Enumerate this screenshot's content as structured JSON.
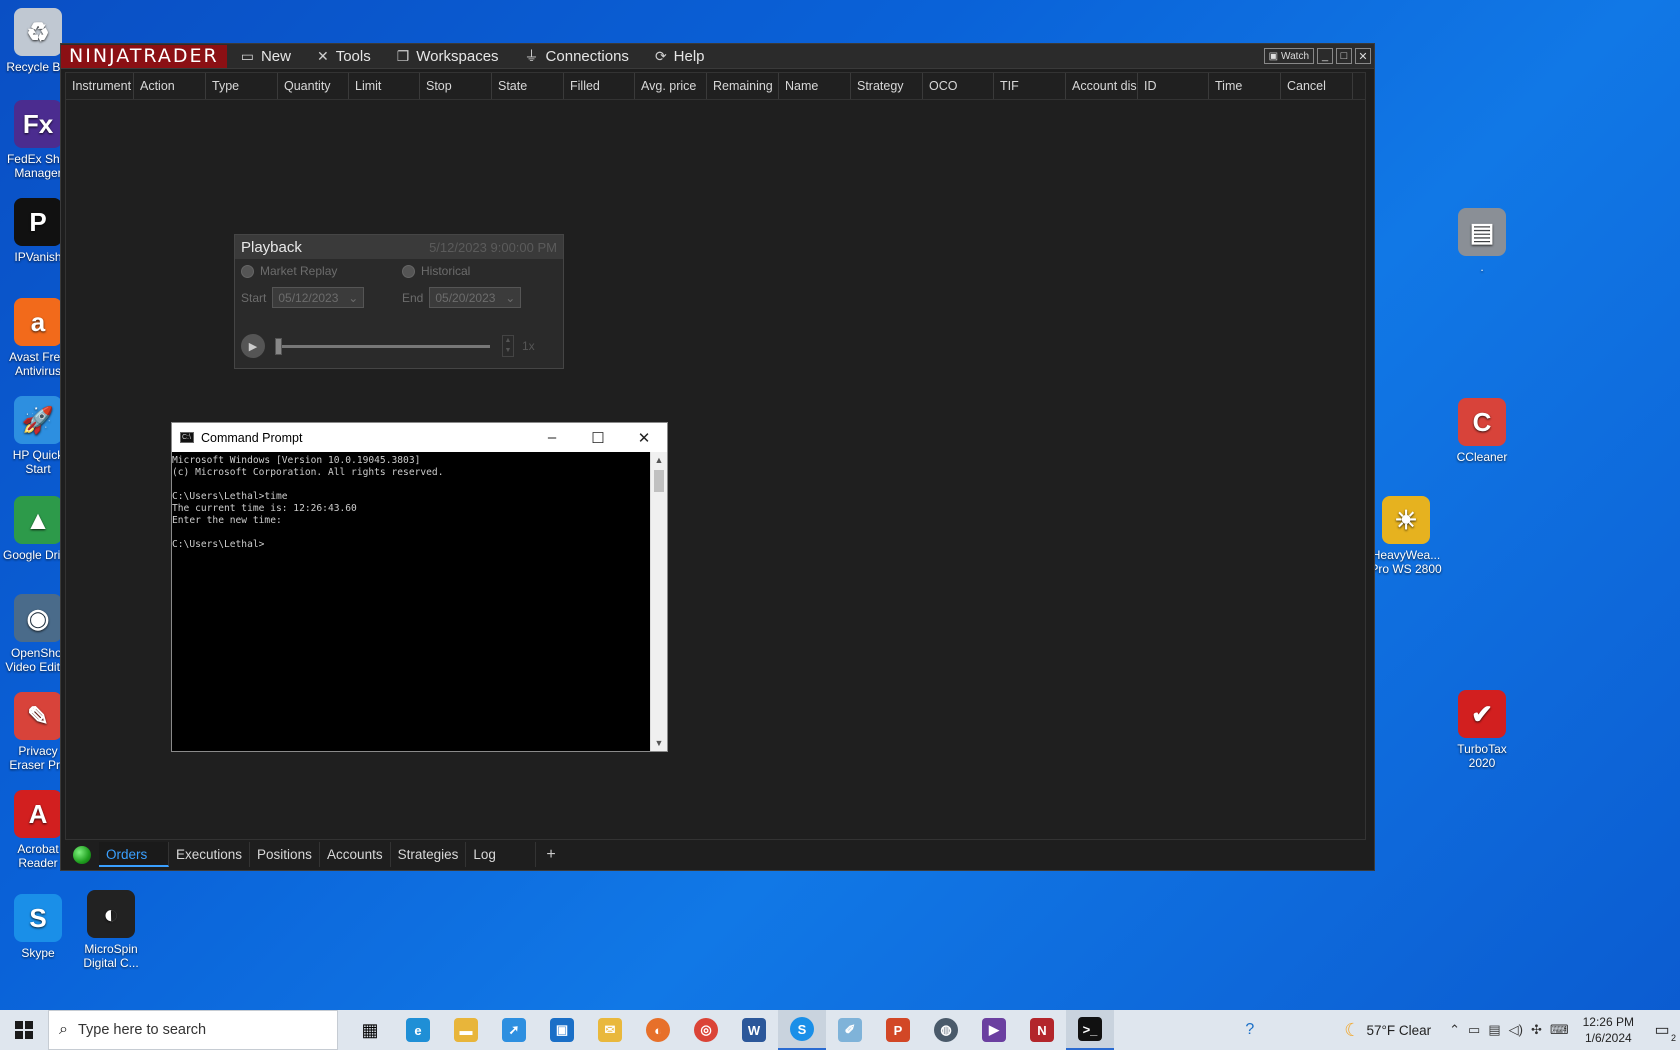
{
  "desktop_left": [
    {
      "label": "Recycle Bin",
      "icon": "recycle-bin-icon",
      "color": "#c0c8d2",
      "glyph": "♻"
    },
    {
      "label": "FedEx Ship Manager",
      "icon": "fedex-icon",
      "color": "#4b2c8f",
      "glyph": "Fx"
    },
    {
      "label": "IPVanish",
      "icon": "ipvanish-icon",
      "color": "#111111",
      "glyph": "P"
    },
    {
      "label": "Avast Free Antivirus",
      "icon": "avast-icon",
      "color": "#f26a1b",
      "glyph": "a"
    },
    {
      "label": "HP Quick Start",
      "icon": "hp-rocket-icon",
      "color": "#2d8fe0",
      "glyph": "🚀"
    },
    {
      "label": "Google Drive",
      "icon": "google-drive-icon",
      "color": "#2d9a4a",
      "glyph": "▲"
    },
    {
      "label": "OpenShot Video Editor",
      "icon": "openshot-icon",
      "color": "#4a6b8a",
      "glyph": "◉"
    },
    {
      "label": "Privacy Eraser Pro",
      "icon": "eraser-icon",
      "color": "#d8433a",
      "glyph": "✎"
    },
    {
      "label": "Acrobat Reader",
      "icon": "acrobat-icon",
      "color": "#d21f1f",
      "glyph": "A"
    },
    {
      "label": "Skype",
      "icon": "skype-icon",
      "color": "#1a8fe8",
      "glyph": "S"
    }
  ],
  "desktop_other": [
    {
      "label": "MicroSpin Digital C...",
      "icon": "microspin-icon",
      "color": "#222222",
      "glyph": "◐"
    },
    {
      "label": "CCleaner",
      "icon": "ccleaner-icon",
      "color": "#d8433a",
      "glyph": "C"
    },
    {
      "label": "HeavyWea... Pro WS 2800",
      "icon": "weather-icon",
      "color": "#e6b21f",
      "glyph": "☀"
    },
    {
      "label": "TurboTax 2020",
      "icon": "turbotax-icon",
      "color": "#d21f1f",
      "glyph": "✔"
    },
    {
      "label": ".",
      "icon": "scanner-icon",
      "color": "#8a8f96",
      "glyph": "▤"
    }
  ],
  "ninjatrader": {
    "logo": "NINJATRADER",
    "menu": [
      {
        "label": "New",
        "icon": "new-window-icon",
        "glyph": "▭"
      },
      {
        "label": "Tools",
        "icon": "tools-icon",
        "glyph": "✕"
      },
      {
        "label": "Workspaces",
        "icon": "workspaces-icon",
        "glyph": "❐"
      },
      {
        "label": "Connections",
        "icon": "plug-icon",
        "glyph": "⏚"
      },
      {
        "label": "Help",
        "icon": "help-icon",
        "glyph": "⟳"
      }
    ],
    "watch_label": "Watch",
    "columns": [
      {
        "label": "Instrument",
        "w": 68
      },
      {
        "label": "Action",
        "w": 72
      },
      {
        "label": "Type",
        "w": 72
      },
      {
        "label": "Quantity",
        "w": 71
      },
      {
        "label": "Limit",
        "w": 71
      },
      {
        "label": "Stop",
        "w": 72
      },
      {
        "label": "State",
        "w": 72
      },
      {
        "label": "Filled",
        "w": 71
      },
      {
        "label": "Avg. price",
        "w": 72
      },
      {
        "label": "Remaining",
        "w": 72
      },
      {
        "label": "Name",
        "w": 72
      },
      {
        "label": "Strategy",
        "w": 72
      },
      {
        "label": "OCO",
        "w": 71
      },
      {
        "label": "TIF",
        "w": 72
      },
      {
        "label": "Account dis",
        "w": 72
      },
      {
        "label": "ID",
        "w": 71
      },
      {
        "label": "Time",
        "w": 72
      },
      {
        "label": "Cancel",
        "w": 72
      }
    ],
    "tabs": [
      "Orders",
      "Executions",
      "Positions",
      "Accounts",
      "Strategies",
      "Log"
    ],
    "active_tab": "Orders"
  },
  "playback": {
    "title": "Playback",
    "datetime": "5/12/2023 9:00:00 PM",
    "market_replay": "Market Replay",
    "historical": "Historical",
    "start_label": "Start",
    "start_value": "05/12/2023",
    "end_label": "End",
    "end_value": "05/20/2023",
    "speed": "1x"
  },
  "cmd": {
    "title": "Command Prompt",
    "lines": "Microsoft Windows [Version 10.0.19045.3803]\n(c) Microsoft Corporation. All rights reserved.\n\nC:\\Users\\Lethal>time\nThe current time is: 12:26:43.60\nEnter the new time:\n\nC:\\Users\\Lethal>"
  },
  "taskbar": {
    "search_placeholder": "Type here to search",
    "weather": "57°F  Clear",
    "time": "12:26 PM",
    "date": "1/6/2024",
    "notifications": "2"
  }
}
